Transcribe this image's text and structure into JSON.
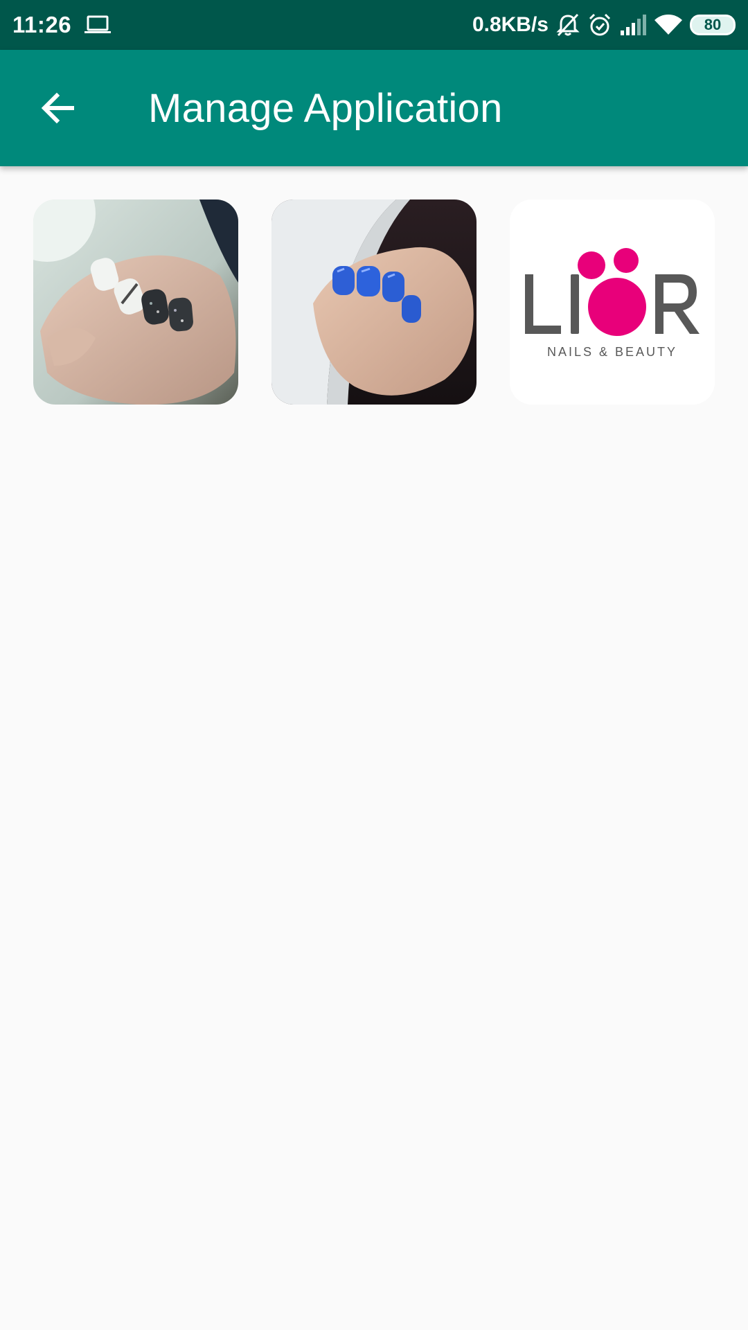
{
  "status_bar": {
    "time": "11:26",
    "network_speed": "0.8KB/s",
    "battery": "80",
    "icons": [
      "laptop-icon",
      "bell-off-icon",
      "alarm-icon",
      "signal-icon",
      "wifi-icon",
      "battery-icon"
    ]
  },
  "app_bar": {
    "title": "Manage Application",
    "back_icon": "arrow-left-icon",
    "color": "#00897b"
  },
  "gallery": {
    "items": [
      {
        "kind": "photo",
        "subject": "nails-white-black-glitter"
      },
      {
        "kind": "photo",
        "subject": "nails-blue"
      },
      {
        "kind": "logo",
        "logo_text": "LIOR",
        "logo_subtitle": "NAILS & BEAUTY",
        "accent": "#e8007a"
      }
    ]
  },
  "colors": {
    "status_bar": "#00574b",
    "app_bar": "#00897b",
    "background": "#fafafa"
  }
}
